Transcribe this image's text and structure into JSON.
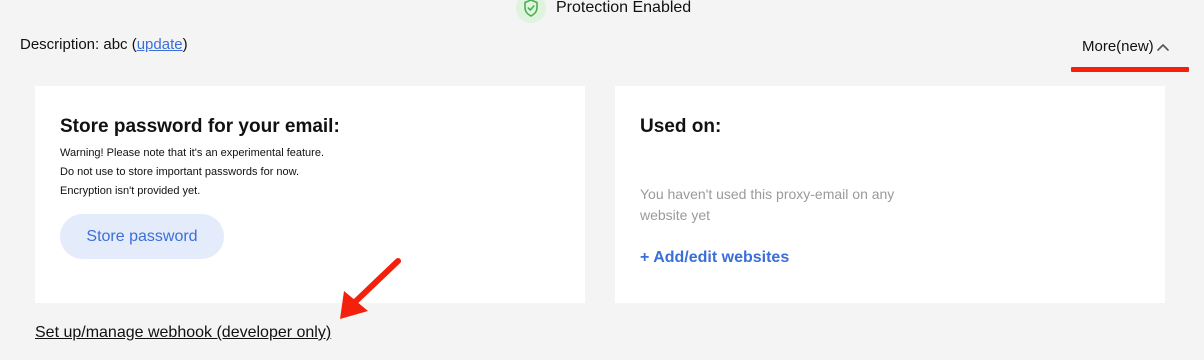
{
  "status": {
    "label": "Protection Enabled",
    "icon": "shield-check-icon",
    "icon_color": "#4caf50"
  },
  "description": {
    "prefix": "Description: abc (",
    "link": "update",
    "suffix": ")"
  },
  "more_toggle": {
    "label": "More(new)",
    "icon": "chevron-up-icon",
    "highlight_color": "#f3200c"
  },
  "password_card": {
    "title": "Store password for your email:",
    "warnings": [
      "Warning! Please note that it's an experimental feature.",
      "Do not use to store important passwords for now.",
      "Encryption isn't provided yet."
    ],
    "button_label": "Store password"
  },
  "used_on_card": {
    "title": "Used on:",
    "empty_text": "You haven't used this proxy-email on any website yet",
    "add_link": "+ Add/edit websites"
  },
  "webhook": {
    "link": "Set up/manage webhook (developer only)"
  },
  "colors": {
    "accent": "#3b6fd8",
    "annotation": "#f3200c",
    "background": "#f4f4f4"
  }
}
